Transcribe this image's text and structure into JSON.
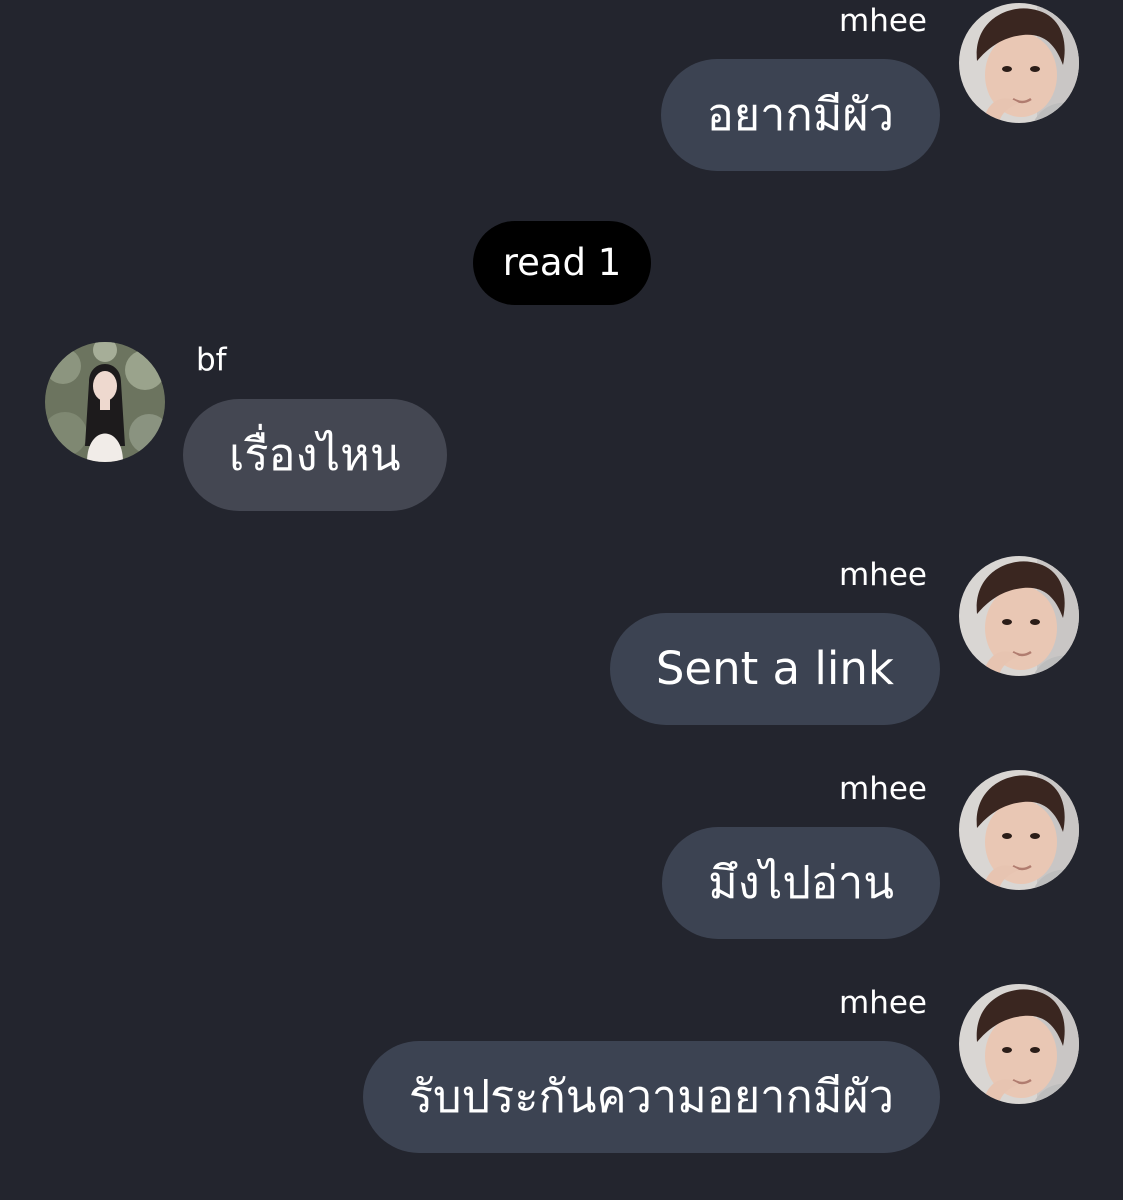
{
  "messages": [
    {
      "sender": "mhee",
      "direction": "outgoing",
      "avatar_icon": "avatar-mhee-icon",
      "text": "อยากมีผัว"
    },
    {
      "type": "status",
      "text": "read 1"
    },
    {
      "sender": "bf",
      "direction": "incoming",
      "avatar_icon": "avatar-bf-icon",
      "text": "เรื่องไหน"
    },
    {
      "sender": "mhee",
      "direction": "outgoing",
      "avatar_icon": "avatar-mhee-icon",
      "text": "Sent a link"
    },
    {
      "sender": "mhee",
      "direction": "outgoing",
      "avatar_icon": "avatar-mhee-icon",
      "text": "มึงไปอ่าน"
    },
    {
      "sender": "mhee",
      "direction": "outgoing",
      "avatar_icon": "avatar-mhee-icon",
      "text": "รับประกันความอยากมีผัว"
    }
  ],
  "colors": {
    "background": "#23252e",
    "outgoing_bubble": "#3c4352",
    "incoming_bubble": "#444752",
    "read_pill": "#000000",
    "text": "#ffffff"
  }
}
